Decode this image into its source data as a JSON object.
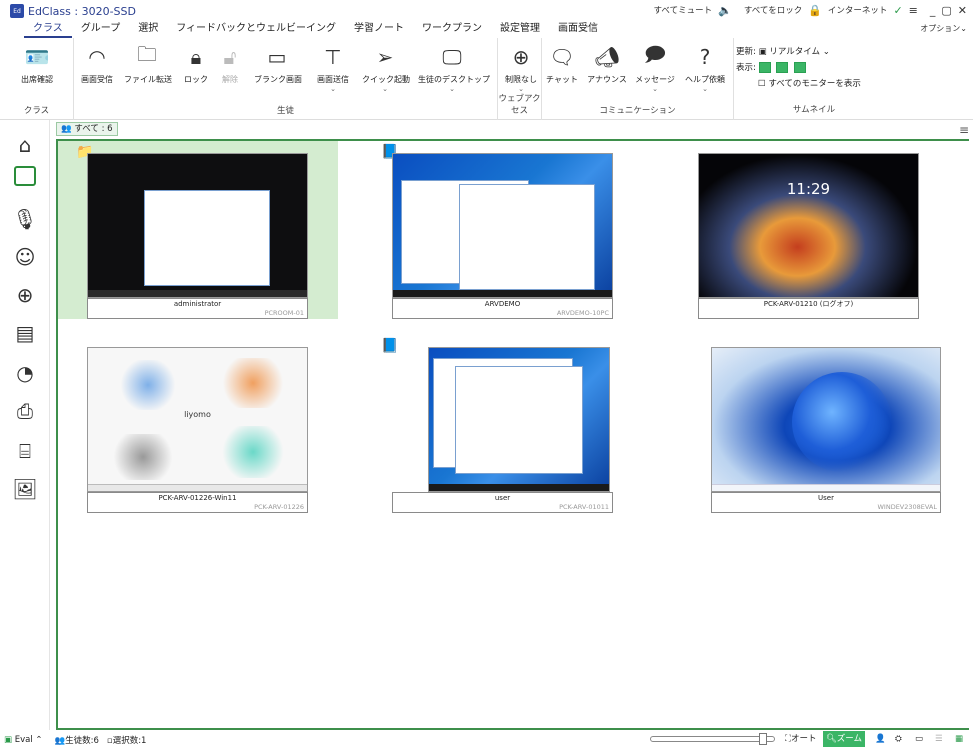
{
  "app": {
    "title": "EdClass : 3020-SSD",
    "logo": "Ed"
  },
  "titlebar": {
    "mute_all": "すべてミュート",
    "lock_all": "すべてをロック",
    "internet": "インターネット",
    "options": "オプション"
  },
  "menu": [
    "クラス",
    "グループ",
    "選択",
    "フィードバックとウェルビーイング",
    "学習ノート",
    "ワークプラン",
    "設定管理",
    "画面受信"
  ],
  "ribbon": {
    "groups": {
      "class": "クラス",
      "students": "生徒",
      "web": "ウェブアクセス",
      "comm": "コミュニケーション",
      "thumb": "サムネイル"
    },
    "buttons": {
      "attendance": "出席確認",
      "screen_receive": "画面受信",
      "file_transfer": "ファイル転送",
      "lock": "ロック",
      "unlock": "解除",
      "blank_screen": "ブランク画面",
      "screen_send": "画面送信",
      "quick_launch": "クイック起動",
      "student_desktop": "生徒のデスクトップ",
      "no_limit": "制限なし",
      "chat": "チャット",
      "announce": "アナウンス",
      "message": "メッセージ",
      "help_request": "ヘルプ依頼"
    },
    "thumbnail": {
      "refresh_label": "更新:",
      "refresh_value": "リアルタイム",
      "display_label": "表示:",
      "all_monitors": "すべてのモニターを表示"
    }
  },
  "tab": {
    "all": "すべて : 6"
  },
  "students": [
    {
      "name": "administrator",
      "pc": "PCROOM-01"
    },
    {
      "name": "ARVDEMO",
      "pc": "ARVDEMO-10PC"
    },
    {
      "name": "PCK-ARV-01210 (ログオフ)",
      "pc": ""
    },
    {
      "name": "PCK-ARV-01226-Win11",
      "pc": "PCK-ARV-01226"
    },
    {
      "name": "user",
      "pc": "PCK-ARV-01011"
    },
    {
      "name": "User",
      "pc": "WINDEV2308EVAL"
    }
  ],
  "lock_screen_time": "11:29",
  "lyomo_text": "liyomo",
  "status": {
    "eval": "Eval",
    "student_count": "生徒数:6",
    "selected_count": "選択数:1",
    "auto": "オート",
    "zoom": "ズーム"
  },
  "zoom_level": 0.92,
  "colors": {
    "accent": "#2a3f8f",
    "green": "#3e8f4b",
    "selection": "#d4ecd0"
  }
}
